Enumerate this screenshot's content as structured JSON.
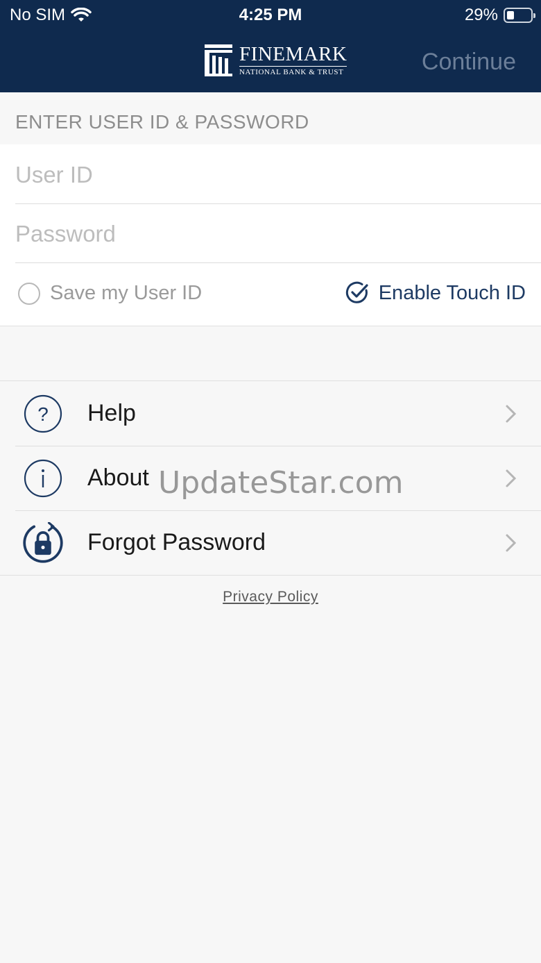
{
  "status_bar": {
    "carrier": "No SIM",
    "time": "4:25 PM",
    "battery": "29%",
    "battery_level": 0.29,
    "wifi_icon": "wifi-icon"
  },
  "header": {
    "logo_name": "FINEMARK",
    "logo_subtitle": "NATIONAL BANK & TRUST",
    "continue_label": "Continue",
    "background_color": "#0f2a4e"
  },
  "login": {
    "section_title": "ENTER USER ID & PASSWORD",
    "user_id_placeholder": "User ID",
    "password_placeholder": "Password",
    "save_user_label": "Save my User ID",
    "save_user_checked": false,
    "touch_id_label": "Enable Touch ID",
    "touch_id_checked": true
  },
  "menu": {
    "items": [
      {
        "label": "Help",
        "icon": "question-circle-icon"
      },
      {
        "label": "About",
        "icon": "info-circle-icon"
      },
      {
        "label": "Forgot Password",
        "icon": "lock-refresh-icon"
      }
    ]
  },
  "footer": {
    "privacy_label": "Privacy Policy"
  },
  "watermark": "UpdateStar.com"
}
